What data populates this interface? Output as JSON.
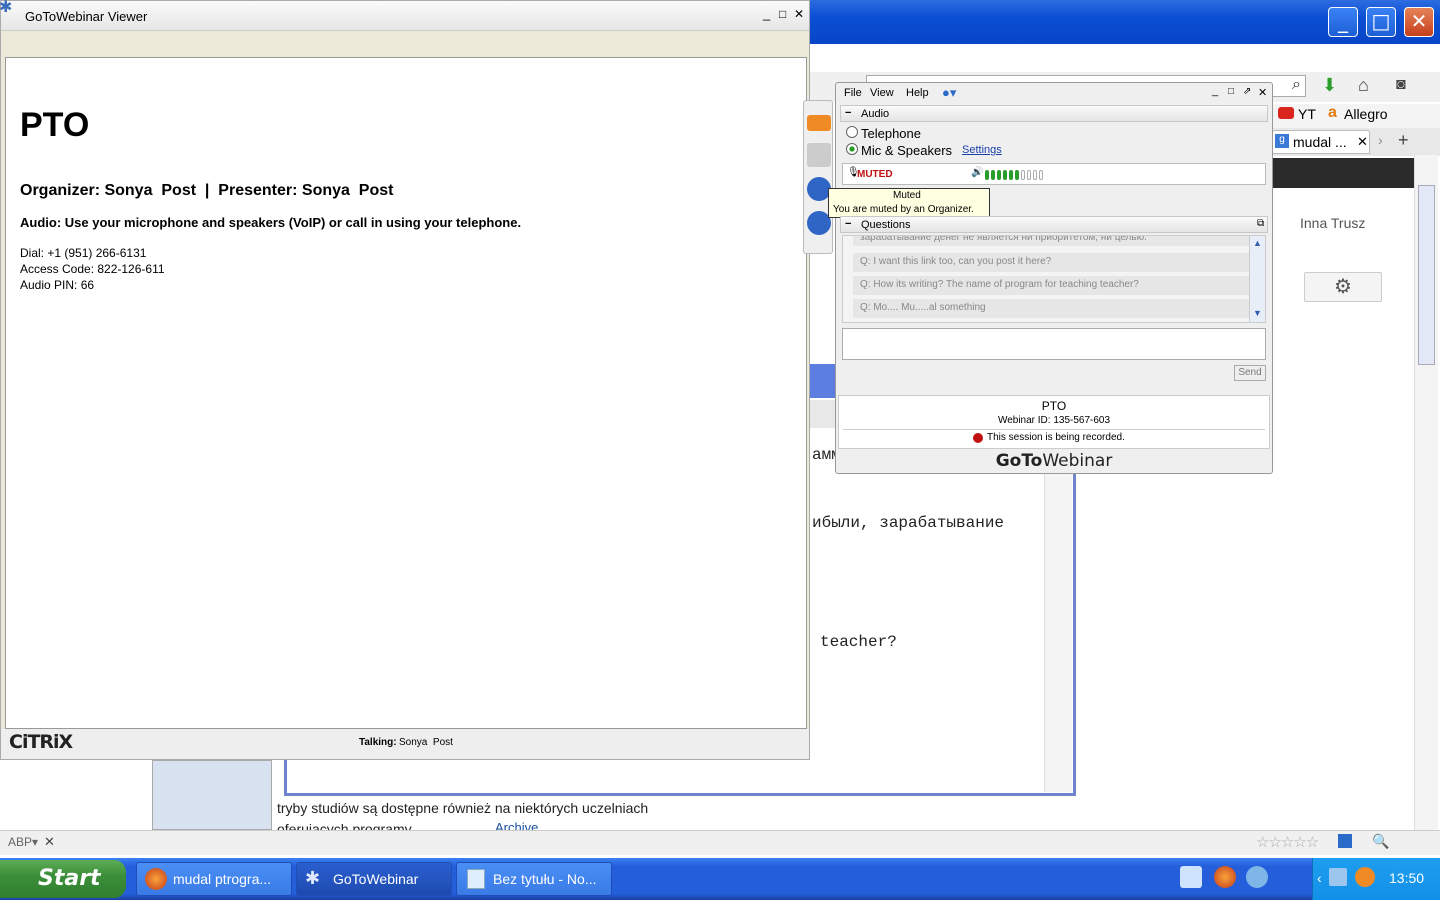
{
  "viewer": {
    "title": "GoToWebinar Viewer",
    "heading": "PTO",
    "organizer_line": "Organizer: Sonya  Post  |  Presenter: Sonya  Post",
    "audio_line": "Audio: Use your microphone and speakers (VoIP) or call in using your telephone.",
    "dial": "Dial: +1 (951) 266-6131",
    "access_code": "Access Code: 822-126-611",
    "audio_pin": "Audio PIN: 66",
    "logo": "CiTRiX",
    "talking_label": "Talking:",
    "talking_name": "Sonya  Post"
  },
  "panel": {
    "menu": [
      "File",
      "View",
      "Help"
    ],
    "audio_header": "Audio",
    "telephone": "Telephone",
    "mic_speakers": "Mic & Speakers",
    "settings": "Settings",
    "muted": "MUTED",
    "tooltip_title": "Muted",
    "tooltip_text": "You are muted by an Organizer.",
    "questions_header": "Questions",
    "questions": [
      "зарабатывание денег не является ни приоритетом, ни целью.",
      "Q: I want this link too, can you post it here?",
      "Q: How its writing? The name of program for teaching teacher?",
      "Q: Mo.... Mu.....al something"
    ],
    "send": "Send",
    "webinar_name": "PTO",
    "webinar_id": "Webinar ID: 135-567-603",
    "recording": "This session is being recorded.",
    "brand_goto": "GoTo",
    "brand_webinar": "Webinar",
    "level_bars": 10,
    "level_active": 6
  },
  "firefox": {
    "bookmark_yt": "YT",
    "bookmark_allegro": "Allegro",
    "tab_label": "mudal ...",
    "user_name": "Inna Trusz",
    "archive": "Archive",
    "snippet_line1": "tryby studiów są dostępne również na niektórych uczelniach",
    "snippet_line2": "oferujących programy"
  },
  "notepad": {
    "text_frag1": "амм",
    "text_frag2": "ибыли, зарабатывание",
    "text_frag3": "teacher?"
  },
  "taskbar": {
    "start": "Start",
    "tasks": [
      "mudal ptrogra...",
      "GoToWebinar",
      "Bez tytułu - No..."
    ],
    "clock": "13:50"
  }
}
